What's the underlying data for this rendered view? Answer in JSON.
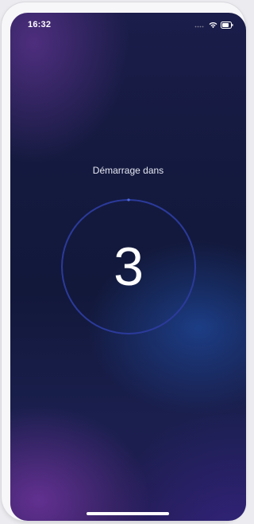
{
  "status_bar": {
    "time": "16:32",
    "icons": [
      "cellular-signal-icon",
      "wifi-icon",
      "battery-icon"
    ]
  },
  "countdown": {
    "label": "Démarrage dans",
    "value": "3"
  },
  "colors": {
    "ring": "#2c3a9c",
    "ring_dot": "#4b63d8",
    "text": "#ffffff"
  }
}
